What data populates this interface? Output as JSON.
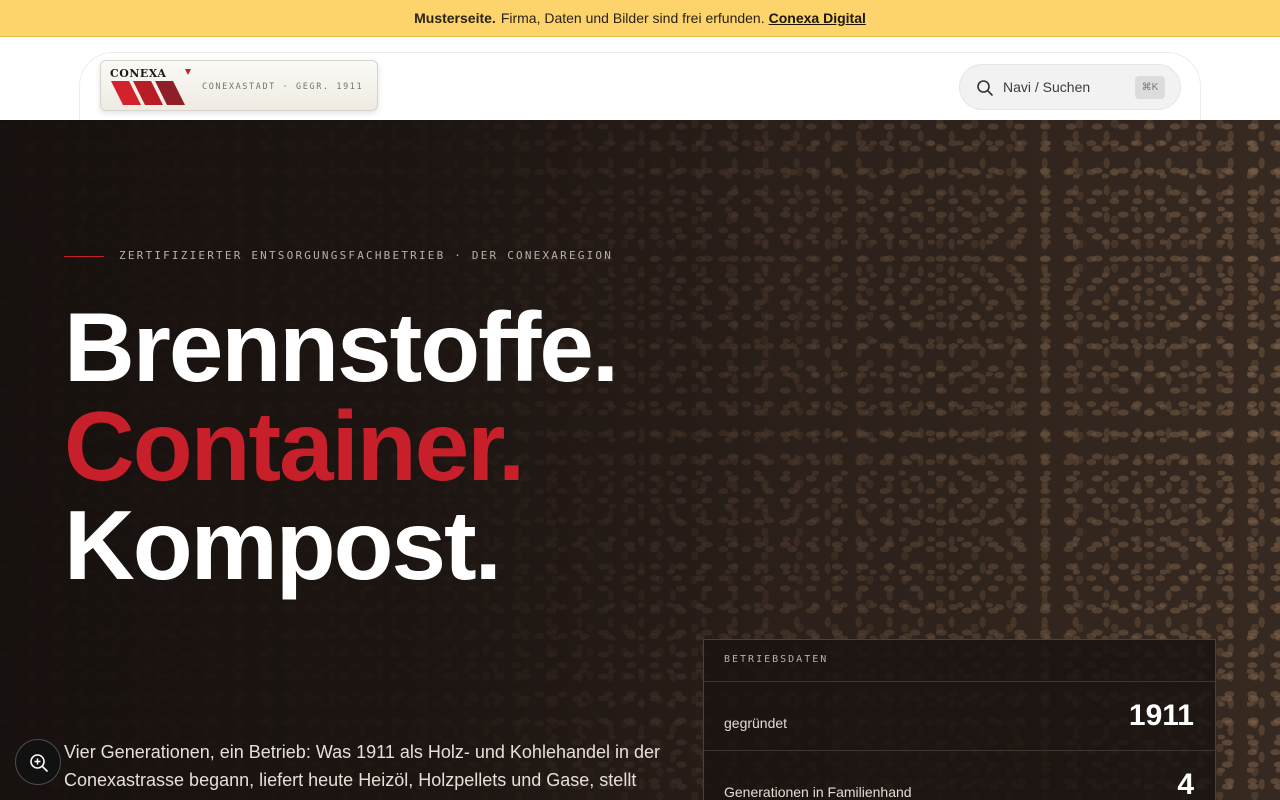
{
  "banner": {
    "bold": "Musterseite.",
    "text": "Firma, Daten und Bilder sind frei erfunden.",
    "link": "Conexa Digital"
  },
  "header": {
    "logo_word": "CONEXA",
    "logo_tagline": "CONEXASTADT · GEGR. 1911",
    "search_placeholder": "Navi / Suchen",
    "search_shortcut": "⌘K",
    "search_icon": "search-icon"
  },
  "hero": {
    "eyebrow": "ZERTIFIZIERTER ENTSORGUNGSFACHBETRIEB · DER CONEXAREGION",
    "headline": [
      "Brennstoffe.",
      "Container.",
      "Kompost."
    ],
    "intro": "Vier Generationen, ein Betrieb: Was 1911 als Holz- und Kohlehandel in der Conexastrasse begann, liefert heute Heizöl, Holzpellets und Gase, stellt",
    "accent_color": "#c7202a"
  },
  "facts": {
    "title": "BETRIEBSDATEN",
    "rows": [
      {
        "label": "gegründet",
        "value": "1911"
      },
      {
        "label": "Generationen in Familienhand",
        "value": "4"
      }
    ]
  },
  "zoom_button": {
    "icon": "zoom-in-icon"
  }
}
